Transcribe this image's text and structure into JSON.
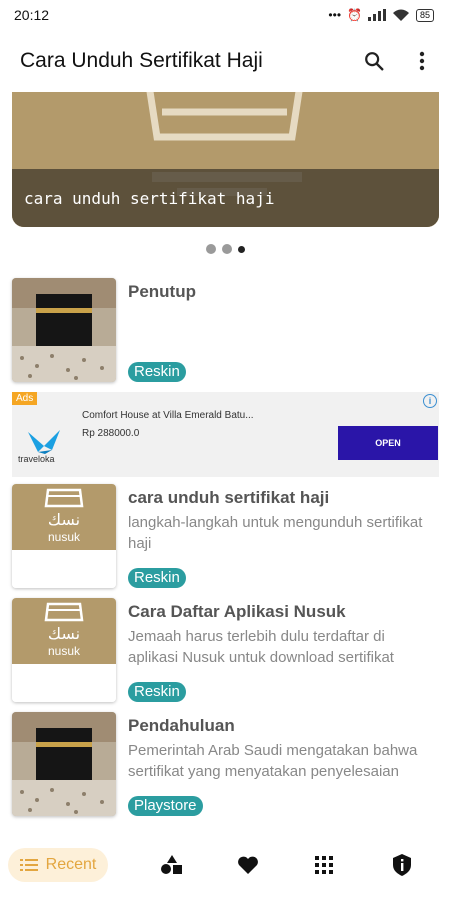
{
  "status": {
    "time": "20:12",
    "battery": "85"
  },
  "appbar": {
    "title": "Cara Unduh Sertifikat Haji",
    "search_icon": "search-icon",
    "menu_icon": "more-vert-icon"
  },
  "banner": {
    "caption": "cara unduh sertifikat haji",
    "slides": 3,
    "active_slide": 3
  },
  "items": [
    {
      "title": "Penutup",
      "desc": "",
      "tag": "Reskin",
      "thumb": "kaaba"
    },
    {
      "title": "cara unduh sertifikat haji",
      "desc": "langkah-langkah untuk mengunduh sertifikat haji",
      "tag": "Reskin",
      "thumb": "nusuk"
    },
    {
      "title": "Cara Daftar Aplikasi Nusuk",
      "desc": "Jemaah harus terlebih dulu terdaftar di aplikasi Nusuk untuk download sertifikat",
      "tag": "Reskin",
      "thumb": "nusuk"
    },
    {
      "title": "Pendahuluan",
      "desc": "Pemerintah Arab Saudi mengatakan bahwa sertifikat yang menyatakan penyelesaian",
      "tag": "Playstore",
      "thumb": "kaaba"
    }
  ],
  "ad": {
    "badge": "Ads",
    "title": "Comfort House at Villa Emerald Batu...",
    "price": "Rp 288000.0",
    "brand": "traveloka",
    "cta": "OPEN"
  },
  "nav": {
    "recent_label": "Recent"
  },
  "thumb_text": {
    "nusuk_arabic": "نسك",
    "nusuk_latin": "nusuk"
  },
  "colors": {
    "accent": "#2b9da0",
    "nav_active": "#e3a640",
    "nusuk_bg": "#b39a6b",
    "ad_button": "#2a15a8"
  }
}
